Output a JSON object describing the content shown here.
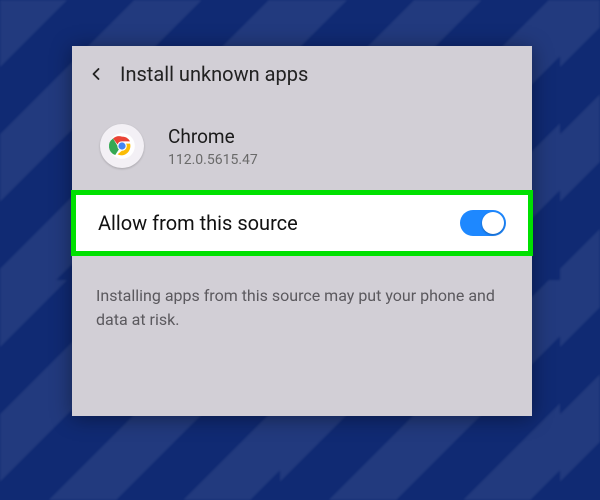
{
  "header": {
    "title": "Install unknown apps"
  },
  "app": {
    "name": "Chrome",
    "version": "112.0.5615.47"
  },
  "allow": {
    "label": "Allow from this source",
    "enabled": true
  },
  "warning": "Installing apps from this source may put your phone and data at risk.",
  "colors": {
    "accent": "#1e88ff",
    "highlight": "#00e000"
  }
}
